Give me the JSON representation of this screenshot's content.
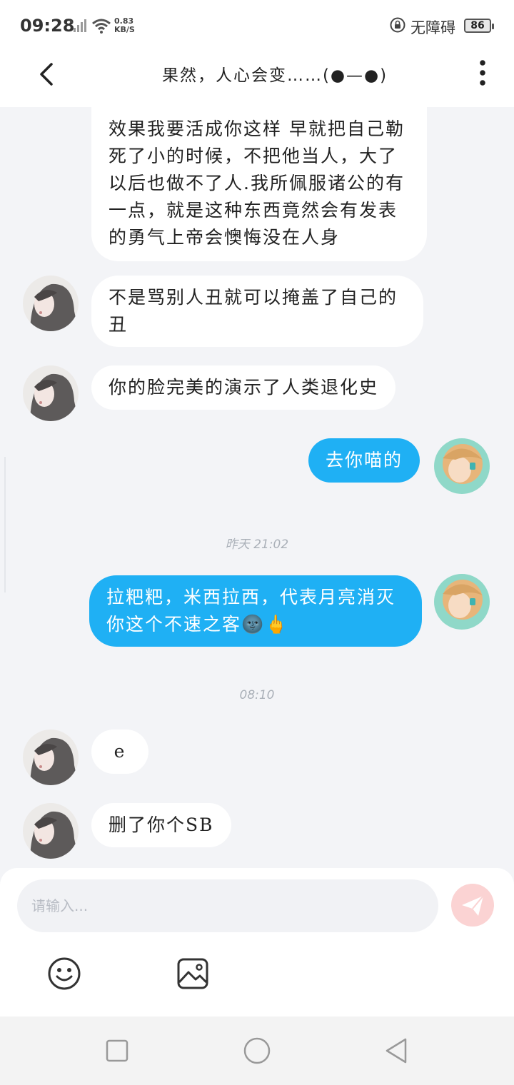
{
  "status_bar": {
    "time": "09:28",
    "net_speed_value": "0.83",
    "net_speed_unit": "KB/S",
    "accessibility": "无障碍",
    "battery": "86"
  },
  "header": {
    "title": "果然，人心会变……(●—●)"
  },
  "messages": [
    {
      "type": "received",
      "text": "效果我要活成你这样 早就把自己勒死了小的时候，不把他当人，大了以后也做不了人.我所佩服诸公的有一点，就是这种东西竟然会有发表的勇气上帝会懊悔没在人身"
    },
    {
      "type": "received",
      "text": "不是骂别人丑就可以掩盖了自己的丑"
    },
    {
      "type": "received",
      "text": "你的脸完美的演示了人类退化史"
    },
    {
      "type": "sent",
      "text": "去你喵的"
    },
    {
      "type": "timestamp",
      "text": "昨天 21:02"
    },
    {
      "type": "sent",
      "text": "拉粑粑，米西拉西，代表月亮消灭你这个不速之客🌚🖕"
    },
    {
      "type": "timestamp",
      "text": "08:10"
    },
    {
      "type": "received",
      "text": "e"
    },
    {
      "type": "received",
      "text": "删了你个SB"
    }
  ],
  "input": {
    "placeholder": "请输入..."
  },
  "icons": {
    "back": "chevron-left-icon",
    "more": "more-vertical-icon",
    "send": "paper-plane-icon",
    "emoji": "smile-icon",
    "image": "image-icon"
  },
  "colors": {
    "sent_bubble": "#1fb0f4",
    "received_bubble": "#ffffff",
    "background": "#f3f4f7",
    "send_button": "#fbd3d3"
  }
}
